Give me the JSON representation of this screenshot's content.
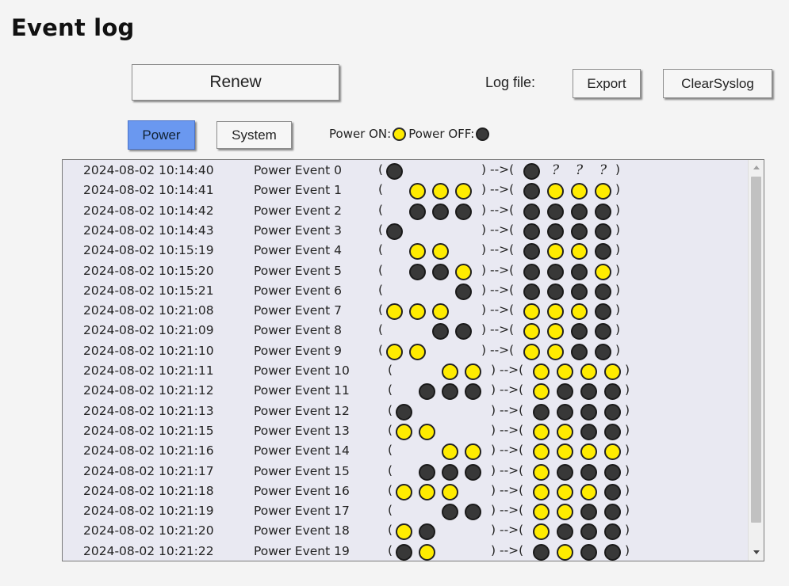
{
  "title": "Event log",
  "buttons": {
    "renew": "Renew",
    "log_file_label": "Log file:",
    "export": "Export",
    "clear_syslog": "ClearSyslog"
  },
  "tabs": {
    "power": "Power",
    "system": "System",
    "active": "power"
  },
  "legend": {
    "on_label": "Power ON:",
    "off_label": "Power OFF:"
  },
  "colors": {
    "on": "#ffec00",
    "off": "#383838",
    "active_tab": "#6a98f0"
  },
  "log": {
    "arrow": "-->",
    "entries": [
      {
        "time": "2024-08-02 10:14:40",
        "event": "Power Event 0",
        "changes": [
          "off",
          "",
          "",
          ""
        ],
        "result": [
          "off",
          "unknown",
          "unknown",
          "unknown"
        ]
      },
      {
        "time": "2024-08-02 10:14:41",
        "event": "Power Event 1",
        "changes": [
          "",
          "on",
          "on",
          "on"
        ],
        "result": [
          "off",
          "on",
          "on",
          "on"
        ]
      },
      {
        "time": "2024-08-02 10:14:42",
        "event": "Power Event 2",
        "changes": [
          "",
          "off",
          "off",
          "off"
        ],
        "result": [
          "off",
          "off",
          "off",
          "off"
        ]
      },
      {
        "time": "2024-08-02 10:14:43",
        "event": "Power Event 3",
        "changes": [
          "off",
          "",
          "",
          ""
        ],
        "result": [
          "off",
          "off",
          "off",
          "off"
        ]
      },
      {
        "time": "2024-08-02 10:15:19",
        "event": "Power Event 4",
        "changes": [
          "",
          "on",
          "on",
          ""
        ],
        "result": [
          "off",
          "on",
          "on",
          "off"
        ]
      },
      {
        "time": "2024-08-02 10:15:20",
        "event": "Power Event 5",
        "changes": [
          "",
          "off",
          "off",
          "on"
        ],
        "result": [
          "off",
          "off",
          "off",
          "on"
        ]
      },
      {
        "time": "2024-08-02 10:15:21",
        "event": "Power Event 6",
        "changes": [
          "",
          "",
          "",
          "off"
        ],
        "result": [
          "off",
          "off",
          "off",
          "off"
        ]
      },
      {
        "time": "2024-08-02 10:21:08",
        "event": "Power Event 7",
        "changes": [
          "on",
          "on",
          "on",
          ""
        ],
        "result": [
          "on",
          "on",
          "on",
          "off"
        ]
      },
      {
        "time": "2024-08-02 10:21:09",
        "event": "Power Event 8",
        "changes": [
          "",
          "",
          "off",
          "off"
        ],
        "result": [
          "on",
          "on",
          "off",
          "off"
        ]
      },
      {
        "time": "2024-08-02 10:21:10",
        "event": "Power Event 9",
        "changes": [
          "on",
          "on",
          "",
          ""
        ],
        "result": [
          "on",
          "on",
          "off",
          "off"
        ]
      },
      {
        "time": "2024-08-02 10:21:11",
        "event": "Power Event 10",
        "changes": [
          "",
          "",
          "on",
          "on"
        ],
        "result": [
          "on",
          "on",
          "on",
          "on"
        ]
      },
      {
        "time": "2024-08-02 10:21:12",
        "event": "Power Event 11",
        "changes": [
          "",
          "off",
          "off",
          "off"
        ],
        "result": [
          "on",
          "off",
          "off",
          "off"
        ]
      },
      {
        "time": "2024-08-02 10:21:13",
        "event": "Power Event 12",
        "changes": [
          "off",
          "",
          "",
          ""
        ],
        "result": [
          "off",
          "off",
          "off",
          "off"
        ]
      },
      {
        "time": "2024-08-02 10:21:15",
        "event": "Power Event 13",
        "changes": [
          "on",
          "on",
          "",
          ""
        ],
        "result": [
          "on",
          "on",
          "off",
          "off"
        ]
      },
      {
        "time": "2024-08-02 10:21:16",
        "event": "Power Event 14",
        "changes": [
          "",
          "",
          "on",
          "on"
        ],
        "result": [
          "on",
          "on",
          "on",
          "on"
        ]
      },
      {
        "time": "2024-08-02 10:21:17",
        "event": "Power Event 15",
        "changes": [
          "",
          "off",
          "off",
          "off"
        ],
        "result": [
          "on",
          "off",
          "off",
          "off"
        ]
      },
      {
        "time": "2024-08-02 10:21:18",
        "event": "Power Event 16",
        "changes": [
          "on",
          "on",
          "on",
          ""
        ],
        "result": [
          "on",
          "on",
          "on",
          "off"
        ]
      },
      {
        "time": "2024-08-02 10:21:19",
        "event": "Power Event 17",
        "changes": [
          "",
          "",
          "off",
          "off"
        ],
        "result": [
          "on",
          "on",
          "off",
          "off"
        ]
      },
      {
        "time": "2024-08-02 10:21:20",
        "event": "Power Event 18",
        "changes": [
          "on",
          "off",
          "",
          ""
        ],
        "result": [
          "on",
          "off",
          "off",
          "off"
        ]
      },
      {
        "time": "2024-08-02 10:21:22",
        "event": "Power Event 19",
        "changes": [
          "off",
          "on",
          "",
          ""
        ],
        "result": [
          "off",
          "on",
          "off",
          "off"
        ]
      }
    ]
  }
}
